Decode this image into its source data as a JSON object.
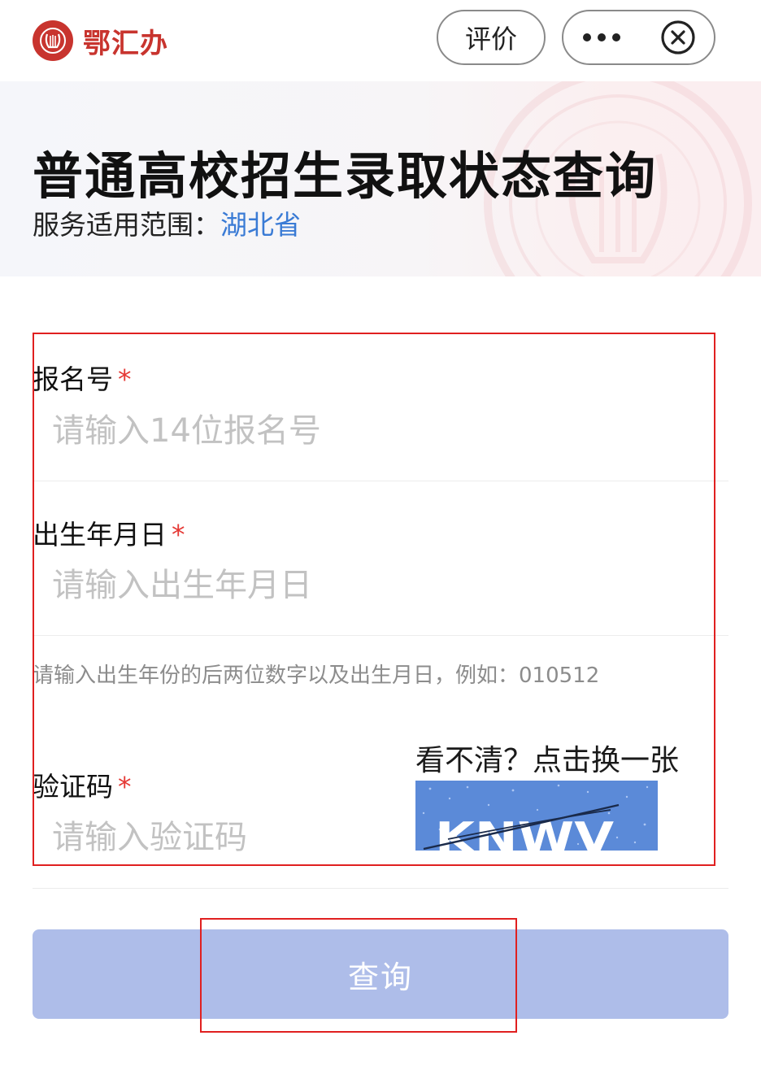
{
  "app": {
    "name": "鄂汇办"
  },
  "topbar": {
    "rate_label": "评价",
    "more_icon": "more-dots-icon",
    "close_icon": "close-circle-icon"
  },
  "banner": {
    "title": "普通高校招生录取状态查询",
    "scope_label": "服务适用范围：",
    "scope_value": "湖北省"
  },
  "form": {
    "fields": [
      {
        "label": "报名号",
        "required_mark": "*",
        "placeholder": "请输入14位报名号",
        "value": ""
      },
      {
        "label": "出生年月日",
        "required_mark": "*",
        "placeholder": "请输入出生年月日",
        "value": ""
      },
      {
        "label": "验证码",
        "required_mark": "*",
        "placeholder": "请输入验证码",
        "value": ""
      }
    ],
    "birth_hint": "请输入出生年份的后两位数字以及出生月日，例如：010512",
    "captcha": {
      "refresh_text": "看不清？点击换一张",
      "code_shown": "KNWV"
    },
    "submit_label": "查询"
  },
  "colors": {
    "brand_red": "#c8342e",
    "link_blue": "#3a7bd5",
    "button_disabled": "#aebde9",
    "required_red": "#e53935",
    "annotation_red": "#e02020",
    "captcha_bg": "#5b8ad8"
  }
}
